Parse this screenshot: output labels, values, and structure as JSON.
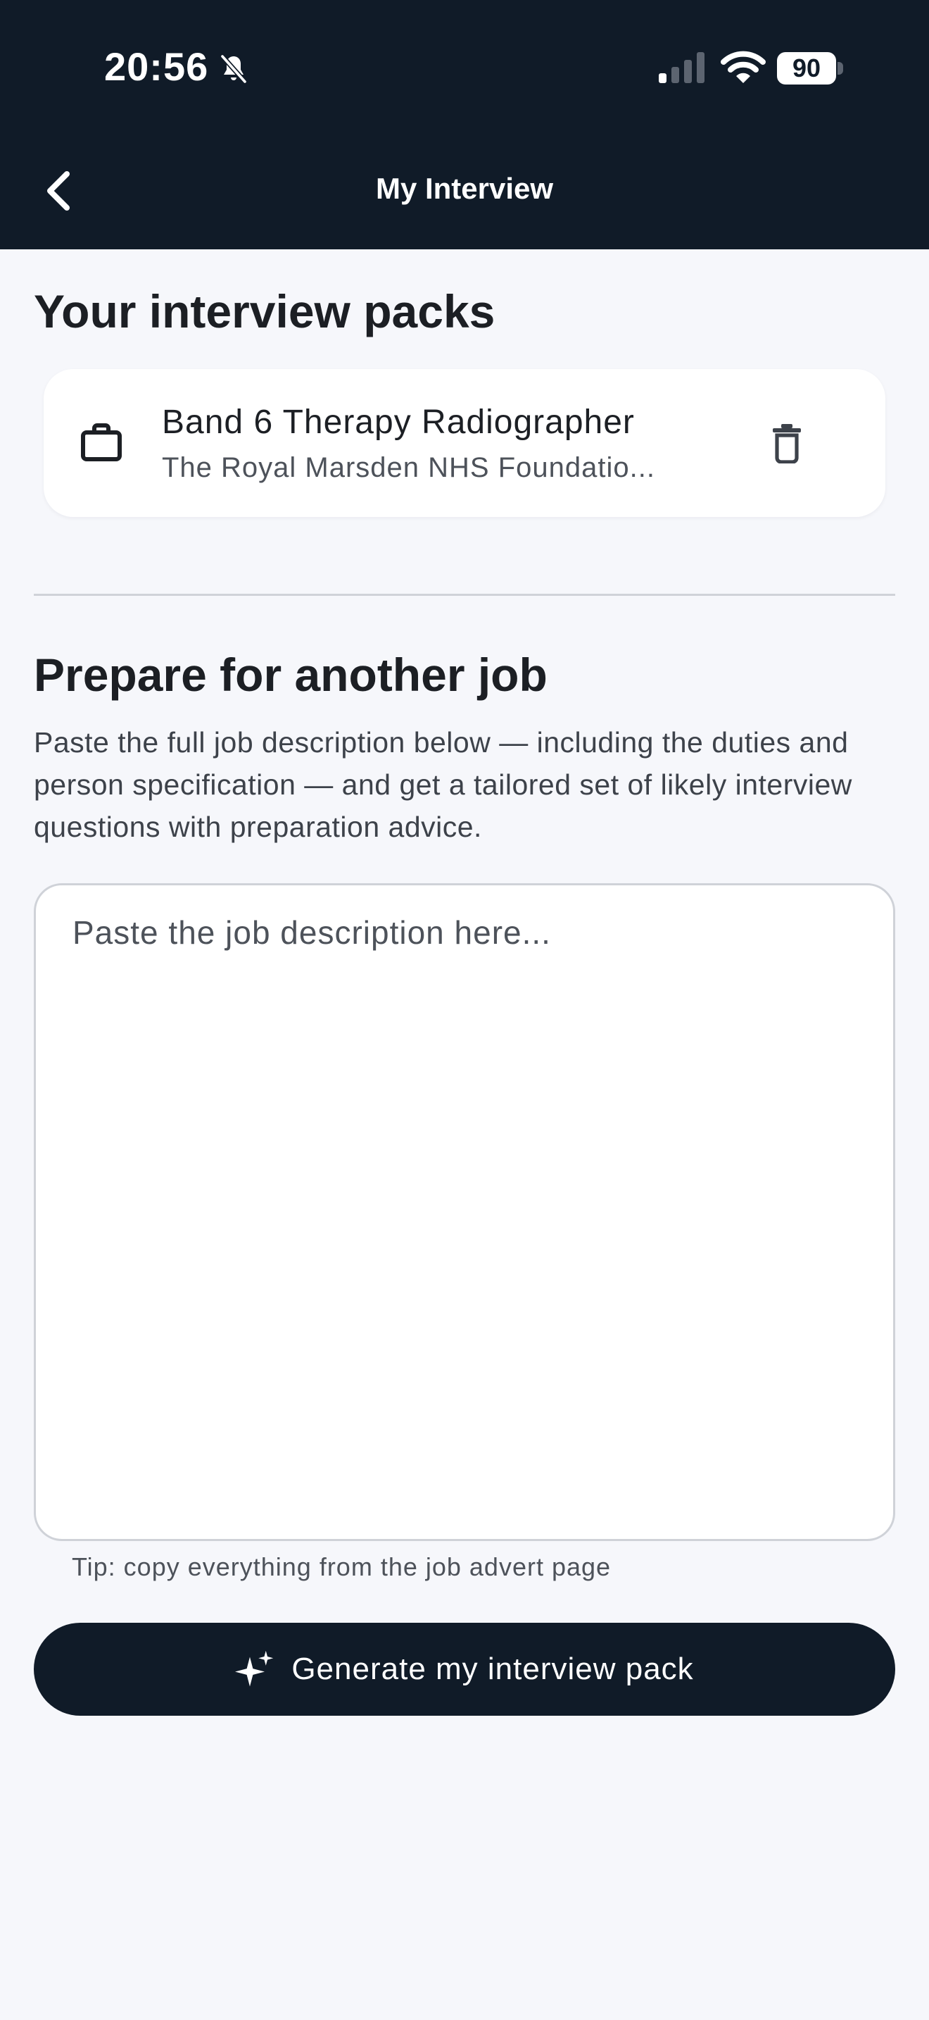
{
  "status_bar": {
    "time": "20:56",
    "battery": "90",
    "icons": [
      "bell-off-icon",
      "cellular-signal-icon",
      "wifi-icon",
      "battery-icon"
    ]
  },
  "header": {
    "title": "My Interview",
    "back_icon": "chevron-left-icon",
    "background": "#101b28"
  },
  "packs": {
    "title": "Your interview packs",
    "items": [
      {
        "icon": "briefcase-icon",
        "title": "Band 6 Therapy Radiographer",
        "subtitle": "The Royal Marsden NHS Foundatio...",
        "action_icon": "trash-icon"
      }
    ]
  },
  "prepare": {
    "title": "Prepare for another job",
    "description": "Paste the full job description below — including the duties and person specification — and get a tailored set of likely interview questions with preparation advice.",
    "textarea": {
      "value": "",
      "placeholder": "Paste the job description here..."
    },
    "tip": "Tip: copy everything from the job advert page",
    "button_label": "Generate my interview pack",
    "button_icon": "sparkle-icon"
  },
  "colors": {
    "primary": "#101b28",
    "background": "#f6f7fb",
    "card": "#ffffff",
    "text": "#1c1f24",
    "muted": "#4d525a",
    "border": "#cfd2d8"
  }
}
